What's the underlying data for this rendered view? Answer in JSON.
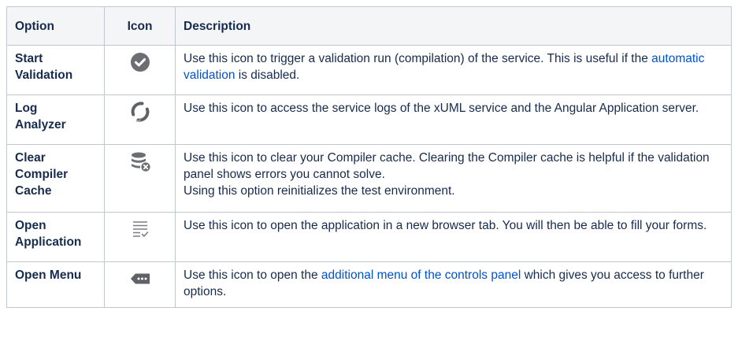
{
  "header": {
    "option": "Option",
    "icon": "Icon",
    "description": "Description"
  },
  "rows": [
    {
      "name_lines": [
        "Start",
        "Validation"
      ],
      "icon": "check-circle-icon",
      "desc": {
        "a": "Use this icon to trigger a validation run (compilation) of the service. This is useful if the ",
        "link": "automatic validation",
        "b": " is disabled."
      }
    },
    {
      "name_lines": [
        "Log",
        "Analyzer"
      ],
      "icon": "log-analyzer-icon",
      "desc": {
        "a": "Use this icon to access the service logs of the xUML service and the Angular Application server."
      }
    },
    {
      "name_lines": [
        "Clear",
        "Compiler",
        "Cache"
      ],
      "icon": "database-clear-icon",
      "desc": {
        "a": "Use this icon to clear your Compiler cache. Clearing the Compiler cache is helpful if the validation panel shows errors you cannot solve.",
        "line2": "Using this option reinitializes the test environment."
      }
    },
    {
      "name_lines": [
        "Open",
        "Application"
      ],
      "icon": "open-application-icon",
      "desc": {
        "a": "Use this icon to open the application in a new browser tab. You will then be able to fill your forms."
      }
    },
    {
      "name_lines": [
        "Open Menu"
      ],
      "icon": "more-menu-icon",
      "desc": {
        "a": "Use this icon to open the ",
        "link": "additional menu of the controls panel",
        "b": " which gives you access to further options."
      }
    }
  ],
  "colors": {
    "border": "#c1c7d0",
    "header_bg": "#f4f5f7",
    "link": "#0052cc",
    "icon_gray": "#6b6e73"
  }
}
